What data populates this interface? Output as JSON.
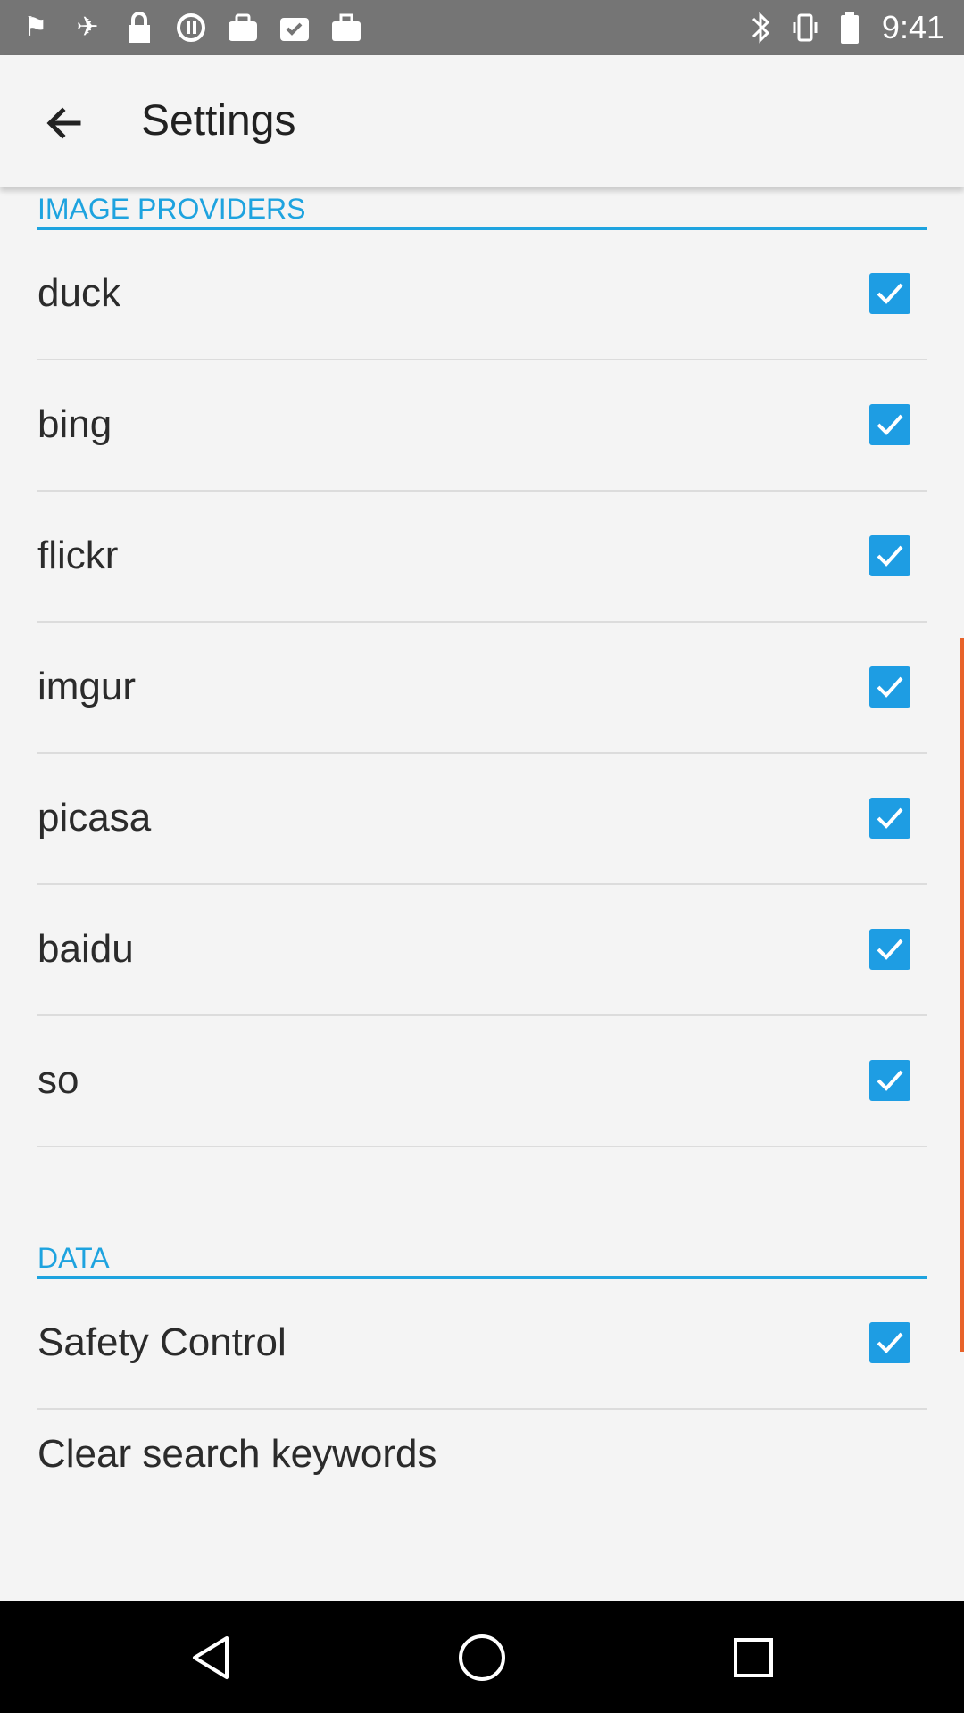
{
  "status_bar": {
    "time": "9:41",
    "left_icons": [
      "flag-icon",
      "satellite-icon",
      "lock-icon",
      "sync-icon",
      "toolbox-icon",
      "checklist-icon",
      "briefcase-icon"
    ],
    "right_icons": [
      "bluetooth-icon",
      "vibrate-icon",
      "battery-icon"
    ]
  },
  "app_bar": {
    "title": "Settings"
  },
  "sections": {
    "image_providers": {
      "header": "IMAGE PROVIDERS",
      "items": [
        {
          "label": "duck",
          "checked": true
        },
        {
          "label": "bing",
          "checked": true
        },
        {
          "label": "flickr",
          "checked": true
        },
        {
          "label": "imgur",
          "checked": true
        },
        {
          "label": "picasa",
          "checked": true
        },
        {
          "label": "baidu",
          "checked": true
        },
        {
          "label": "so",
          "checked": true
        }
      ]
    },
    "data": {
      "header": "DATA",
      "safety_control": {
        "label": "Safety Control",
        "checked": true
      },
      "clear_keywords": {
        "label": "Clear search keywords"
      }
    }
  },
  "colors": {
    "accent": "#1ea3df",
    "checkbox": "#1e9de3",
    "scroll_indicator": "#e8632a",
    "status_bar": "#757575"
  }
}
